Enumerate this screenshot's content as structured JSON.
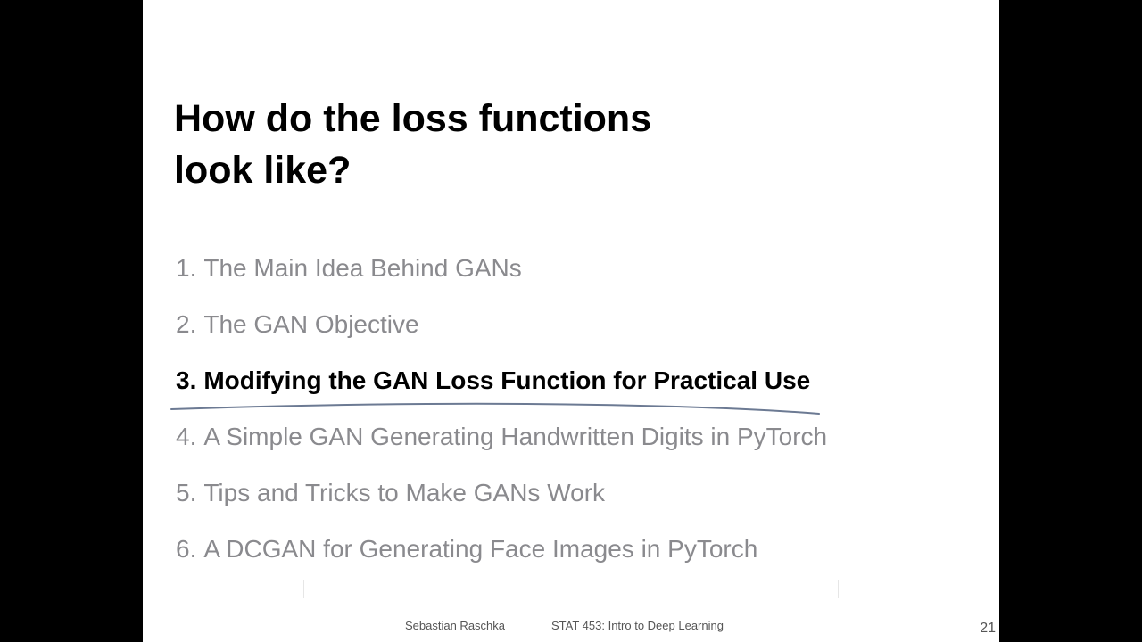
{
  "slide": {
    "title_lines": [
      "How do the loss functions",
      "look like?"
    ],
    "agenda": [
      {
        "number": "1.",
        "text": "The Main Idea Behind GANs",
        "active": false
      },
      {
        "number": "2.",
        "text": "The GAN Objective",
        "active": false
      },
      {
        "number": "3.",
        "text": "Modifying the GAN Loss Function for Practical Use",
        "active": true
      },
      {
        "number": "4.",
        "text": "A Simple GAN Generating Handwritten Digits in PyTorch",
        "active": false
      },
      {
        "number": "5.",
        "text": "Tips and Tricks to Make GANs Work",
        "active": false
      },
      {
        "number": "6.",
        "text": "A DCGAN for Generating Face Images in PyTorch",
        "active": false
      }
    ],
    "footer": {
      "author": "Sebastian Raschka",
      "course": "STAT 453: Intro to Deep Learning",
      "page_number": "21"
    }
  },
  "colors": {
    "active_item": "#000000",
    "inactive_item": "#8a8a8e",
    "annotation_ink": "#6c7a93",
    "background": "#ffffff",
    "letterbox": "#000000"
  }
}
